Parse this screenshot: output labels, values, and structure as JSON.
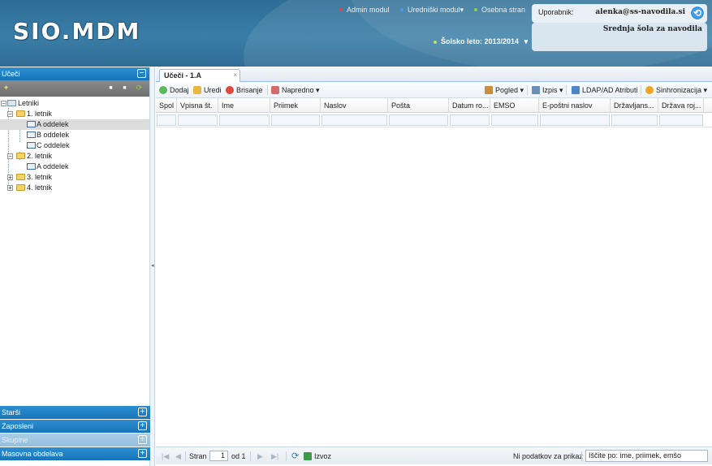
{
  "header": {
    "logo": "SIO.MDM",
    "nav": [
      {
        "label": "Admin modul",
        "dot_color": "#e0473d"
      },
      {
        "label": "Uredniški modul▾",
        "dot_color": "#46a0e8"
      },
      {
        "label": "Osebna stran",
        "dot_color": "#8fcf4a"
      }
    ],
    "school_year": "Šolsko leto: 2013/2014",
    "school_year_caret": "▾",
    "user_label": "Uporabnik:",
    "user_email": "alenka@ss-navodila.si",
    "school_name": "Srednja šola za navodila"
  },
  "sidebar": {
    "title": "Učeči",
    "collapse_symbol": "−",
    "tree": {
      "root": "Letniki",
      "years": [
        {
          "label": "1. letnik",
          "expanded": true,
          "classes": [
            "A oddelek",
            "B oddelek",
            "C oddelek"
          ]
        },
        {
          "label": "2. letnik",
          "expanded": true,
          "classes": [
            "A oddelek"
          ]
        },
        {
          "label": "3. letnik",
          "expanded": false,
          "classes": []
        },
        {
          "label": "4. letnik",
          "expanded": false,
          "classes": []
        }
      ],
      "selected": "1. letnik / A oddelek"
    },
    "sections": [
      {
        "label": "Starši",
        "symbol": "+"
      },
      {
        "label": "Zaposleni",
        "symbol": "+"
      },
      {
        "label": "Skupine",
        "symbol": "+"
      },
      {
        "label": "Masovna obdelava",
        "symbol": "+"
      }
    ]
  },
  "tab": {
    "label": "Učeči - 1.A",
    "close": "×"
  },
  "toolbar": {
    "add": "Dodaj",
    "edit": "Uredi",
    "delete": "Brisanje",
    "advanced": "Napredno ▾",
    "view": "Pogled ▾",
    "print": "Izpis ▾",
    "ldap": "LDAP/AD Atributi",
    "sync": "Sinhronizacija ▾"
  },
  "grid": {
    "columns": [
      "Spol",
      "Vpisna št.",
      "Ime",
      "Priimek",
      "Naslov",
      "Pošta",
      "Datum ro...",
      "EMSO",
      "E-poštni naslov",
      "Državljans...",
      "Država roj..."
    ]
  },
  "pager": {
    "first": "|◀",
    "prev": "◀",
    "page_label": "Stran",
    "page_value": "1",
    "of_label": "od 1",
    "next": "▶",
    "last": "▶|",
    "refresh": "⟳",
    "export": "Izvoz",
    "no_data": "Ni podatkov za prikaz",
    "search_value": "Iščite po: ime, priimek, emšo"
  },
  "colors": {
    "header_bg": "#3a7ea8",
    "panel_title": "#1b7fc2",
    "section_disabled": "#9cc3df",
    "accent_blue": "#3d9be6"
  }
}
